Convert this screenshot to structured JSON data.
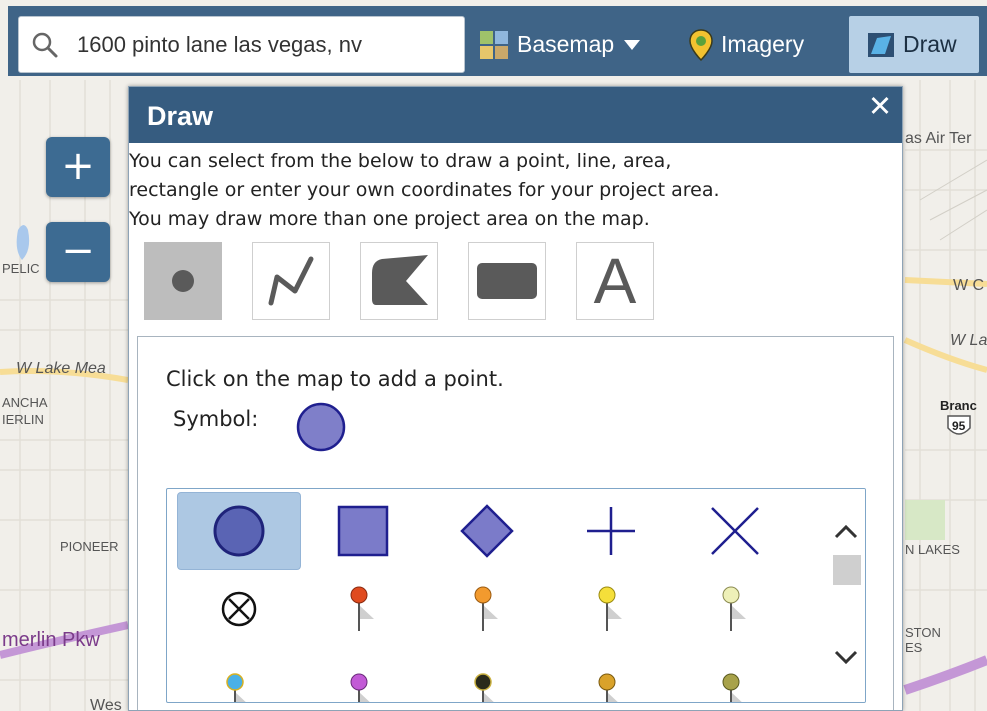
{
  "search": {
    "value": "1600 pinto lane las vegas, nv"
  },
  "toolbar": {
    "basemap_label": "Basemap",
    "imagery_label": "Imagery",
    "draw_label": "Draw"
  },
  "zoom": {
    "in_label": "+",
    "out_label": "−"
  },
  "map_labels": {
    "w_lake_mead": "W Lake Mea",
    "rancho_1": "ANCHA",
    "rancho_2": "IERLIN",
    "pelican": "PELIC",
    "pioneer": "PIONEER",
    "summerlin": "merlin Pkw",
    "west": "Wes",
    "las_air": "as Air Ter",
    "w_c": "W C",
    "w_la": "W La",
    "branch": "Branc",
    "route": "95",
    "n_lakes": "N LAKES",
    "ston": "STON",
    "es": "ES"
  },
  "panel": {
    "title": "Draw",
    "close_glyph": "✕",
    "intro_lines": [
      "You can select from the below to draw a point, line, area,",
      "rectangle or enter your own coordinates for your project area.",
      "You may draw more than one project area on the map."
    ],
    "tools": [
      {
        "name": "point",
        "active": true
      },
      {
        "name": "line",
        "active": false
      },
      {
        "name": "area",
        "active": false
      },
      {
        "name": "rectangle",
        "active": false
      },
      {
        "name": "text",
        "glyph": "A",
        "active": false
      }
    ],
    "hint": "Click on the map to add a point.",
    "symbol_label": "Symbol:",
    "symbol_color": "#7f7fc9",
    "symbol_stroke": "#1f1f8f"
  },
  "symbols": [
    "circle-icon",
    "square-icon",
    "diamond-icon",
    "cross-icon",
    "x-icon",
    "circle-x-icon",
    "red-pin-icon",
    "orange-pin-icon",
    "yellow-pin-icon",
    "pale-pin-icon",
    "blue-pin-icon",
    "purple-pin-icon",
    "black-pin-icon",
    "gold-pin-icon",
    "olive-pin-icon"
  ],
  "colors": {
    "toolbar": "#3f6487",
    "panel_header": "#365c80",
    "selected_cell": "#adc8e3",
    "symbol_fill": "#7f7fc9"
  }
}
